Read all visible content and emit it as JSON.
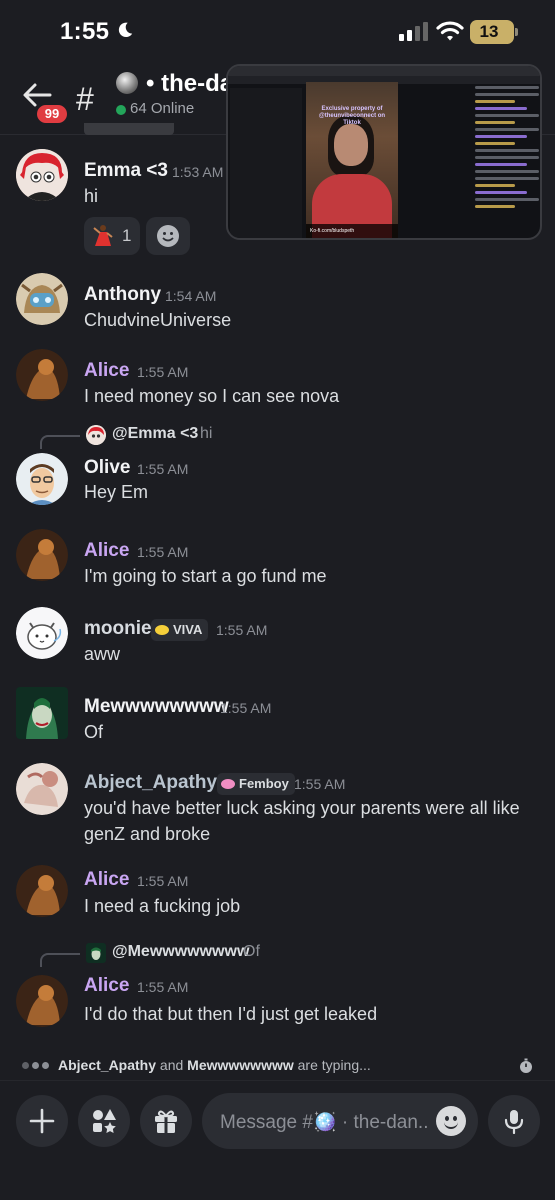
{
  "status_bar": {
    "time": "1:55",
    "battery": "13"
  },
  "header": {
    "unread_count": "99",
    "channel_name": "• the-da",
    "online": "64 Online"
  },
  "pip": {
    "caption": "Exclusive property of @theunvibeconnect on Tiktok",
    "footer": "Ko-fi.com/bludspeth"
  },
  "messages": [
    {
      "author": "Emma <3",
      "author_color": "#f2f3f5",
      "time": "1:53 AM",
      "text": "hi",
      "reaction_count": "1"
    },
    {
      "author": "Anthony",
      "author_color": "#f2f3f5",
      "time": "1:54 AM",
      "text": "ChudvineUniverse"
    },
    {
      "author": "Alice",
      "author_color": "#c9a6f2",
      "time": "1:55 AM",
      "text": "I need money so I can see nova"
    },
    {
      "reply_author": "@Emma <3",
      "reply_text": "hi",
      "author": "Olive",
      "author_color": "#f2f3f5",
      "time": "1:55 AM",
      "text": "Hey Em"
    },
    {
      "author": "Alice",
      "author_color": "#c9a6f2",
      "time": "1:55 AM",
      "text": "I'm going to start a go fund me"
    },
    {
      "author": "moonie",
      "author_color": "#d7dbe0",
      "badge": "VIVA",
      "badge_color": "#f5cf3a",
      "time": "1:55 AM",
      "text": "aww"
    },
    {
      "author": "Mewwwwwwww",
      "author_color": "#f2f3f5",
      "time": "1:55 AM",
      "text": "Of"
    },
    {
      "author": "Abject_Apathy",
      "author_color": "#b9c4cf",
      "badge": "Femboy",
      "badge_color": "#f08ec3",
      "time": "1:55 AM",
      "text": "you'd have better luck asking your parents were all like genZ and broke"
    },
    {
      "author": "Alice",
      "author_color": "#c9a6f2",
      "time": "1:55 AM",
      "text": "I need a fucking job"
    },
    {
      "reply_author": "@Mewwwwwwww",
      "reply_text": "Of",
      "author": "Alice",
      "author_color": "#c9a6f2",
      "time": "1:55 AM",
      "text": "I'd do that but then I'd just get leaked"
    }
  ],
  "typing": {
    "user1": "Abject_Apathy",
    "connector": " and ",
    "user2": "Mewwwwwwww",
    "suffix": " are typing..."
  },
  "composer": {
    "placeholder": "Message #🪩 · the-dan.."
  },
  "icons": {
    "back": "arrow-left-icon",
    "hash": "hash-icon",
    "add": "plus-icon",
    "apps": "apps-icon",
    "gift": "gift-icon",
    "emoji": "emoji-icon",
    "mic": "microphone-icon"
  }
}
